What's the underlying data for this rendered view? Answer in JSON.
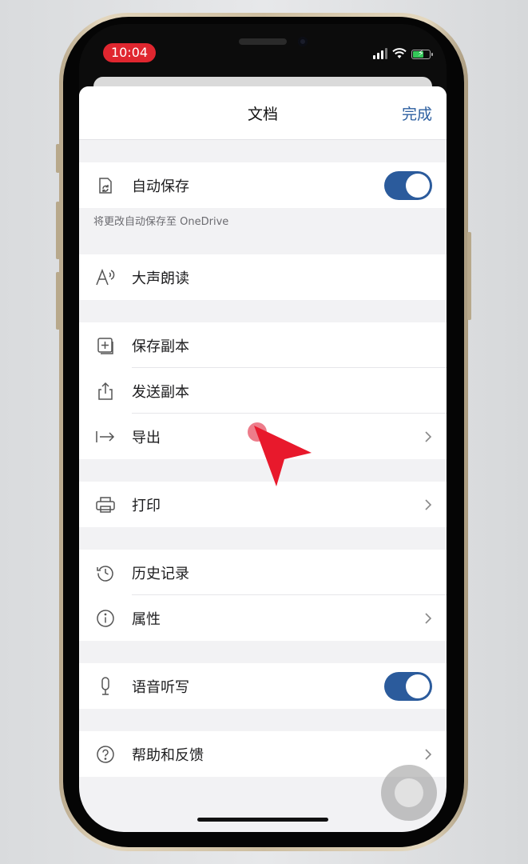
{
  "status_bar": {
    "time": "10:04"
  },
  "header": {
    "title": "文档",
    "done_label": "完成"
  },
  "autosave": {
    "label": "自动保存",
    "enabled": true,
    "note": "将更改自动保存至 OneDrive"
  },
  "read_aloud": {
    "label": "大声朗读"
  },
  "save_copy": {
    "label": "保存副本"
  },
  "send_copy": {
    "label": "发送副本"
  },
  "export": {
    "label": "导出"
  },
  "print": {
    "label": "打印"
  },
  "history": {
    "label": "历史记录"
  },
  "properties": {
    "label": "属性"
  },
  "dictation": {
    "label": "语音听写",
    "enabled": true
  },
  "help": {
    "label": "帮助和反馈"
  },
  "colors": {
    "accent": "#2b5b9c",
    "done_text": "#2c5fa0",
    "time_pill": "#e0262f",
    "cursor": "#e8192c"
  }
}
